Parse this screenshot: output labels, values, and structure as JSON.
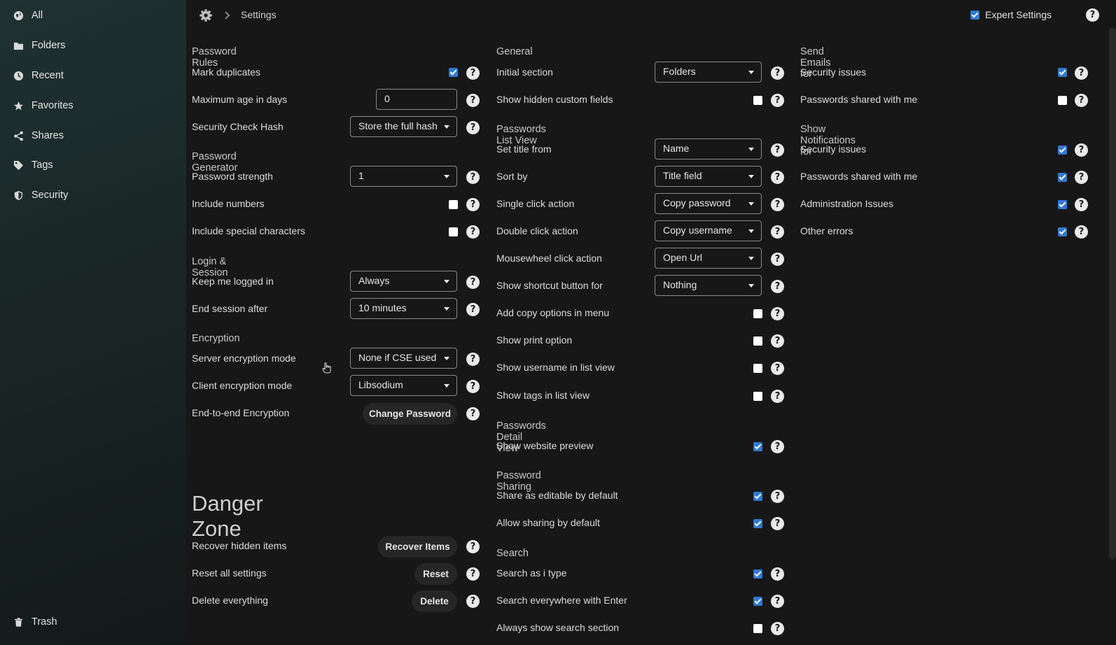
{
  "sidebar": {
    "items": [
      {
        "label": "All",
        "icon": "globe-icon"
      },
      {
        "label": "Folders",
        "icon": "folder-icon"
      },
      {
        "label": "Recent",
        "icon": "clock-icon"
      },
      {
        "label": "Favorites",
        "icon": "star-icon"
      },
      {
        "label": "Shares",
        "icon": "share-icon"
      },
      {
        "label": "Tags",
        "icon": "tag-icon"
      },
      {
        "label": "Security",
        "icon": "shield-icon"
      }
    ],
    "trash": "Trash"
  },
  "breadcrumb": {
    "current": "Settings"
  },
  "expert_settings": {
    "label": "Expert Settings",
    "checked": true
  },
  "col1": {
    "password_rules": {
      "title": "Password Rules",
      "mark_duplicates": "Mark duplicates",
      "max_age": "Maximum age in days",
      "max_age_value": "0",
      "hash": "Security Check Hash",
      "hash_value": "Store the full hash"
    },
    "generator": {
      "title": "Password Generator",
      "strength": "Password strength",
      "strength_value": "1",
      "numbers": "Include numbers",
      "special": "Include special characters"
    },
    "session": {
      "title": "Login & Session",
      "keep": "Keep me logged in",
      "keep_value": "Always",
      "end": "End session after",
      "end_value": "10 minutes"
    },
    "encryption": {
      "title": "Encryption",
      "server": "Server encryption mode",
      "server_value": "None if CSE used",
      "client": "Client encryption mode",
      "client_value": "Libsodium",
      "e2e": "End-to-end Encryption",
      "e2e_button": "Change Password"
    },
    "danger": {
      "title": "Danger Zone",
      "recover": "Recover hidden items",
      "recover_button": "Recover Items",
      "reset": "Reset all settings",
      "reset_button": "Reset",
      "delete": "Delete everything",
      "delete_button": "Delete"
    }
  },
  "col2": {
    "general": {
      "title": "General",
      "initial": "Initial section",
      "initial_value": "Folders",
      "hidden_fields": "Show hidden custom fields"
    },
    "list_view": {
      "title": "Passwords List View",
      "set_title": "Set title from",
      "set_title_value": "Name",
      "sort": "Sort by",
      "sort_value": "Title field",
      "single": "Single click action",
      "single_value": "Copy password",
      "double": "Double click action",
      "double_value": "Copy username",
      "wheel": "Mousewheel click action",
      "wheel_value": "Open Url",
      "shortcut": "Show shortcut button for",
      "shortcut_value": "Nothing",
      "copy_opts": "Add copy options in menu",
      "print": "Show print option",
      "username": "Show username in list view",
      "tags": "Show tags in list view"
    },
    "detail_view": {
      "title": "Passwords Detail View",
      "preview": "Show website preview"
    },
    "sharing": {
      "title": "Password Sharing",
      "editable": "Share as editable by default",
      "allow": "Allow sharing by default"
    },
    "search": {
      "title": "Search",
      "as_type": "Search as i type",
      "everywhere": "Search everywhere with Enter",
      "always": "Always show search section"
    }
  },
  "col3": {
    "emails": {
      "title": "Send Emails for",
      "security": "Security issues",
      "shared": "Passwords shared with me"
    },
    "notifications": {
      "title": "Show Notifications for",
      "security": "Security issues",
      "shared": "Passwords shared with me",
      "admin": "Administration Issues",
      "other": "Other errors"
    }
  },
  "help_glyph": "?",
  "colors": {
    "accent": "#2e7ad1",
    "sidebar": "#1f3131",
    "background": "#171717"
  }
}
